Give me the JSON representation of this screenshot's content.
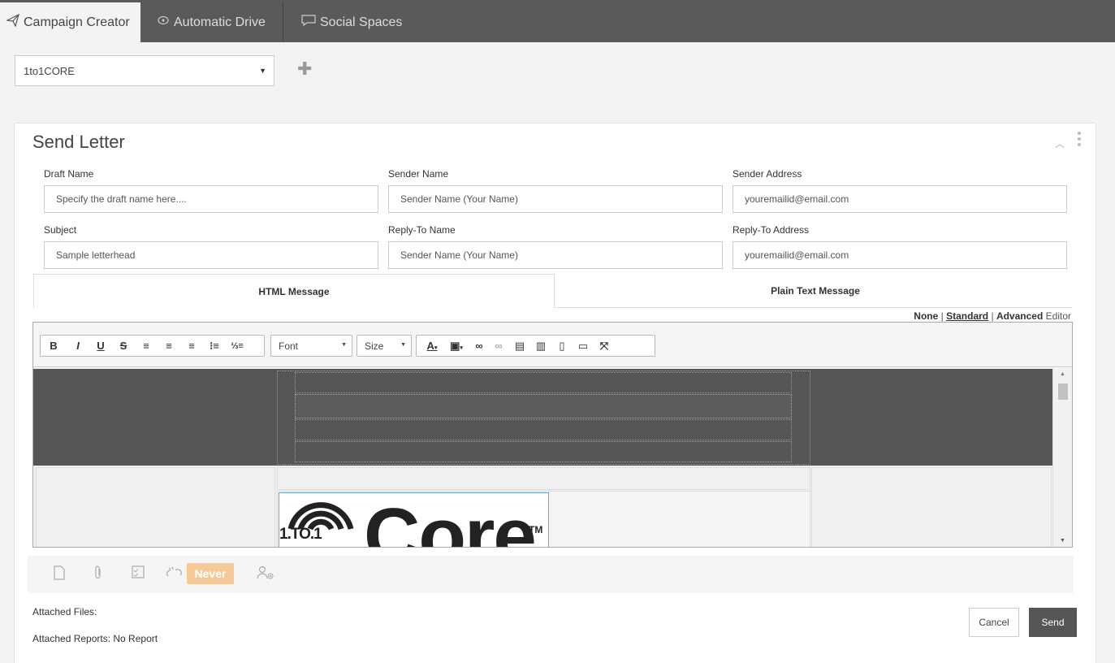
{
  "tabs": [
    {
      "label": "Campaign Creator",
      "icon": "paper-plane-icon",
      "active": true
    },
    {
      "label": "Automatic Drive",
      "icon": "drive-icon",
      "active": false
    },
    {
      "label": "Social Spaces",
      "icon": "chat-icon",
      "active": false
    }
  ],
  "account": {
    "selected": "1to1CORE"
  },
  "panel": {
    "title": "Send Letter"
  },
  "form": {
    "draft_name": {
      "label": "Draft Name",
      "placeholder": "Specify the draft name here...."
    },
    "sender_name": {
      "label": "Sender Name",
      "placeholder": "Sender Name (Your Name)"
    },
    "sender_address": {
      "label": "Sender Address",
      "value": "youremailid@email.com"
    },
    "subject": {
      "label": "Subject",
      "value": "Sample letterhead"
    },
    "reply_to_name": {
      "label": "Reply-To Name",
      "placeholder": "Sender Name (Your Name)"
    },
    "reply_to_address": {
      "label": "Reply-To Address",
      "value": "youremailid@email.com"
    }
  },
  "message_tabs": {
    "html": "HTML Message",
    "plain": "Plain Text Message"
  },
  "editor_mode": {
    "none": "None",
    "sep": "|",
    "standard": "Standard",
    "advanced": "Advanced",
    "suffix": "Editor"
  },
  "toolbar": {
    "font": "Font",
    "size": "Size"
  },
  "logo": {
    "brand": "Core",
    "tm": "TM",
    "prefix": "1.TO.1"
  },
  "expiry": {
    "label": "Never"
  },
  "attachments": {
    "files_label": "Attached Files:",
    "reports_label": "Attached Reports: No Report"
  },
  "buttons": {
    "cancel": "Cancel",
    "send": "Send"
  }
}
